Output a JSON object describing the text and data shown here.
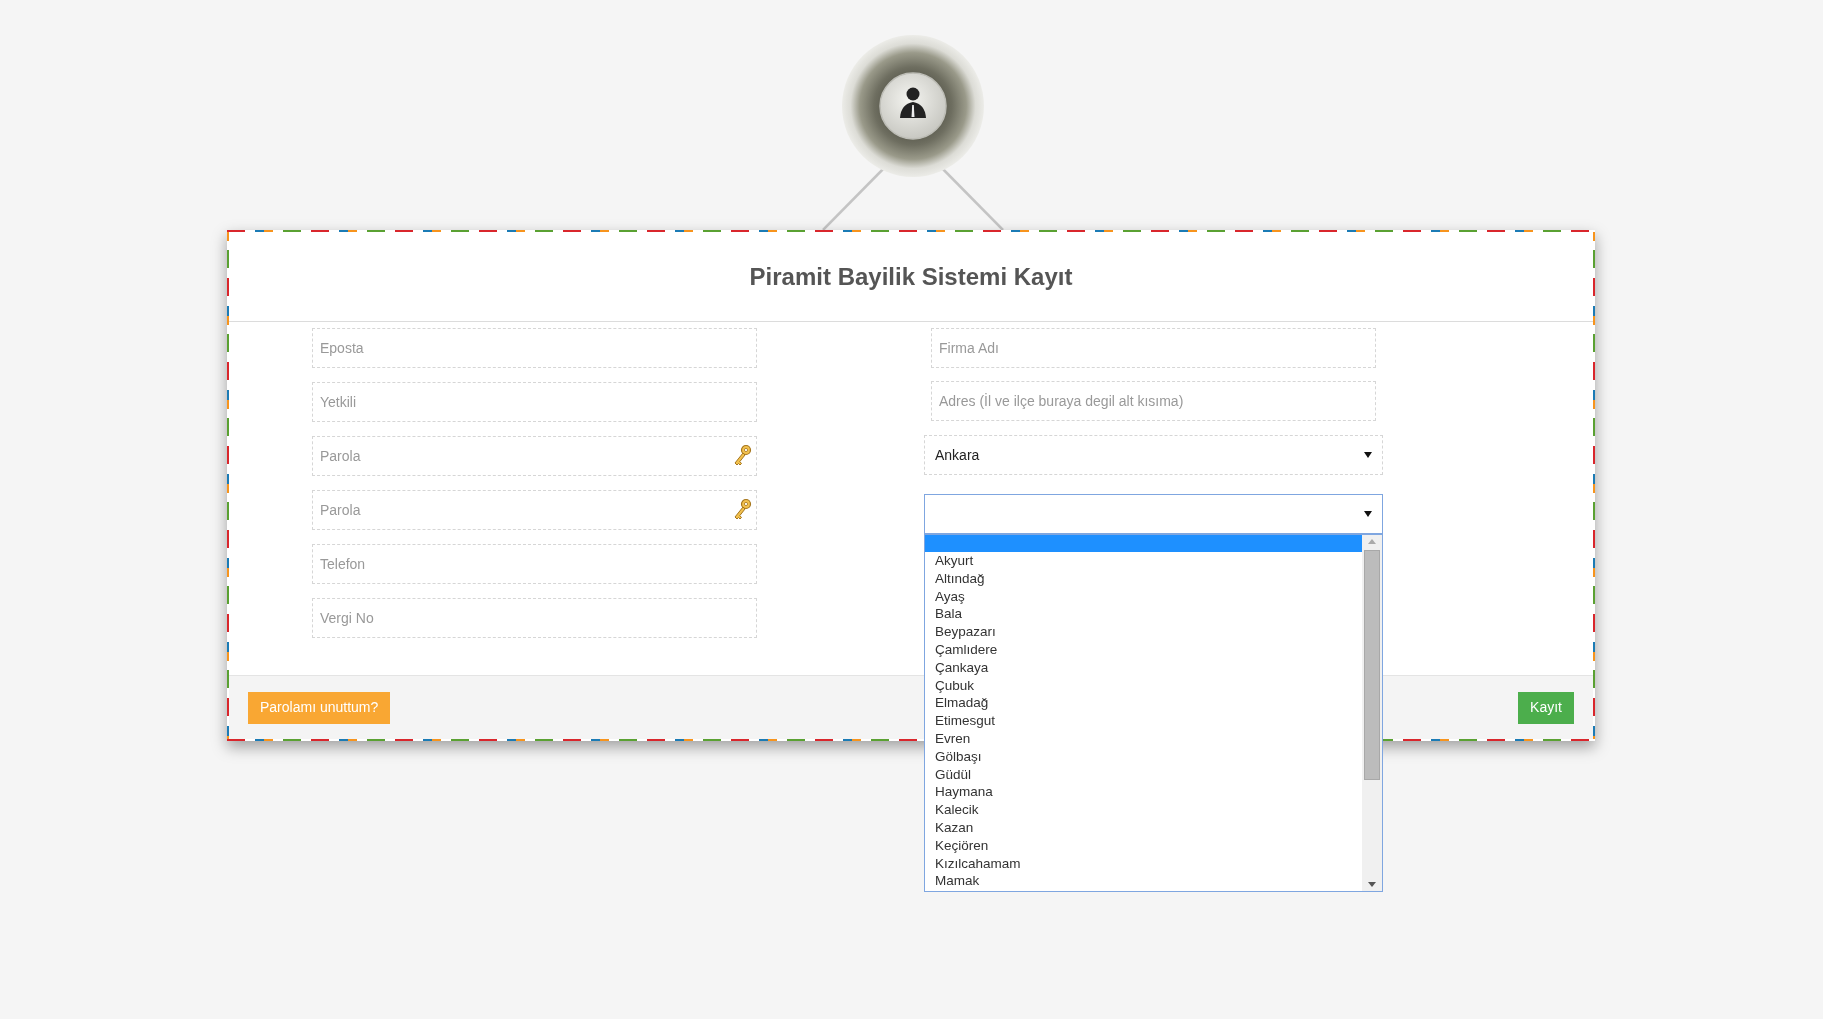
{
  "title": "Piramit Bayilik Sistemi Kayıt",
  "left_fields": [
    {
      "placeholder": "Eposta",
      "kind": "text"
    },
    {
      "placeholder": "Yetkili",
      "kind": "text"
    },
    {
      "placeholder": "Parola",
      "kind": "password"
    },
    {
      "placeholder": "Parola",
      "kind": "password"
    },
    {
      "placeholder": "Telefon",
      "kind": "text"
    },
    {
      "placeholder": "Vergi No",
      "kind": "text"
    }
  ],
  "right_fields": [
    {
      "placeholder": "Firma Adı"
    },
    {
      "placeholder": "Adres (İl ve ilçe buraya degil alt kısıma)"
    }
  ],
  "city_select": {
    "value": "Ankara",
    "expanded": false
  },
  "district_select": {
    "expanded": true,
    "blank_option_highlighted": true,
    "options": [
      {
        "label": "Akyurt",
        "selected": false
      },
      {
        "label": "Altındağ",
        "selected": false
      },
      {
        "label": "Ayaş",
        "selected": false
      },
      {
        "label": "Bala",
        "selected": false
      },
      {
        "label": "Beypazarı",
        "selected": false
      },
      {
        "label": "Çamlıdere",
        "selected": false
      },
      {
        "label": "Çankaya",
        "selected": false
      },
      {
        "label": "Çubuk",
        "selected": false
      },
      {
        "label": "Elmadağ",
        "selected": false
      },
      {
        "label": "Etimesgut",
        "selected": false
      },
      {
        "label": "Evren",
        "selected": false
      },
      {
        "label": "Gölbaşı",
        "selected": false
      },
      {
        "label": "Güdül",
        "selected": false
      },
      {
        "label": "Haymana",
        "selected": false
      },
      {
        "label": "Kalecik",
        "selected": false
      },
      {
        "label": "Kazan",
        "selected": false
      },
      {
        "label": "Keçiören",
        "selected": false
      },
      {
        "label": "Kızılcahamam",
        "selected": false
      },
      {
        "label": "Mamak",
        "selected": false
      }
    ]
  },
  "footer_buttons": [
    {
      "label": "Parolamı unuttum?",
      "kind": "warning"
    },
    {
      "label": "Kayıt",
      "kind": "success"
    }
  ]
}
